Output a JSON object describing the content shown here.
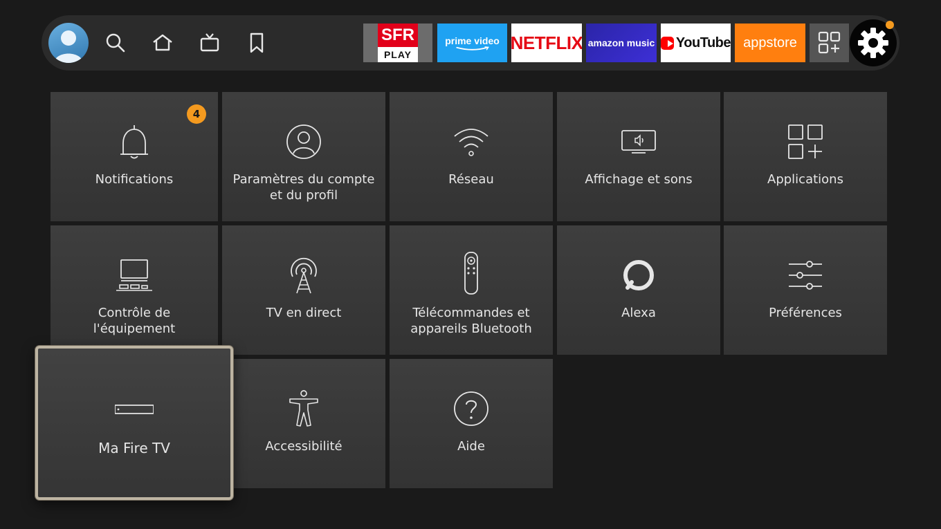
{
  "topbar": {
    "apps": {
      "sfr_top": "SFR",
      "sfr_bottom": "PLAY",
      "prime_video": "prime video",
      "netflix": "NETFLIX",
      "amazon_music": "amazon music",
      "youtube": "YouTube",
      "appstore": "appstore"
    },
    "settings_dot_color": "#f49a1f"
  },
  "settings": {
    "tiles": [
      {
        "label": "Notifications",
        "icon": "bell-icon",
        "badge": "4"
      },
      {
        "label": "Paramètres du compte et du profil",
        "icon": "account-icon"
      },
      {
        "label": "Réseau",
        "icon": "wifi-icon"
      },
      {
        "label": "Affichage et sons",
        "icon": "display-sound-icon"
      },
      {
        "label": "Applications",
        "icon": "apps-icon"
      },
      {
        "label": "Contrôle de l'équipement",
        "icon": "equipment-icon"
      },
      {
        "label": "TV en direct",
        "icon": "antenna-icon"
      },
      {
        "label": "Télécommandes et appareils Bluetooth",
        "icon": "remote-icon"
      },
      {
        "label": "Alexa",
        "icon": "alexa-icon"
      },
      {
        "label": "Préférences",
        "icon": "sliders-icon"
      },
      {
        "label": "Ma Fire TV",
        "icon": "fire-tv-device-icon",
        "focused": true
      },
      {
        "label": "Accessibilité",
        "icon": "accessibility-icon"
      },
      {
        "label": "Aide",
        "icon": "help-icon"
      }
    ]
  },
  "colors": {
    "background": "#1a1a1a",
    "tile": "#3a3a3a",
    "badge": "#f49a1f",
    "focus_border": "#bdb4a2"
  }
}
